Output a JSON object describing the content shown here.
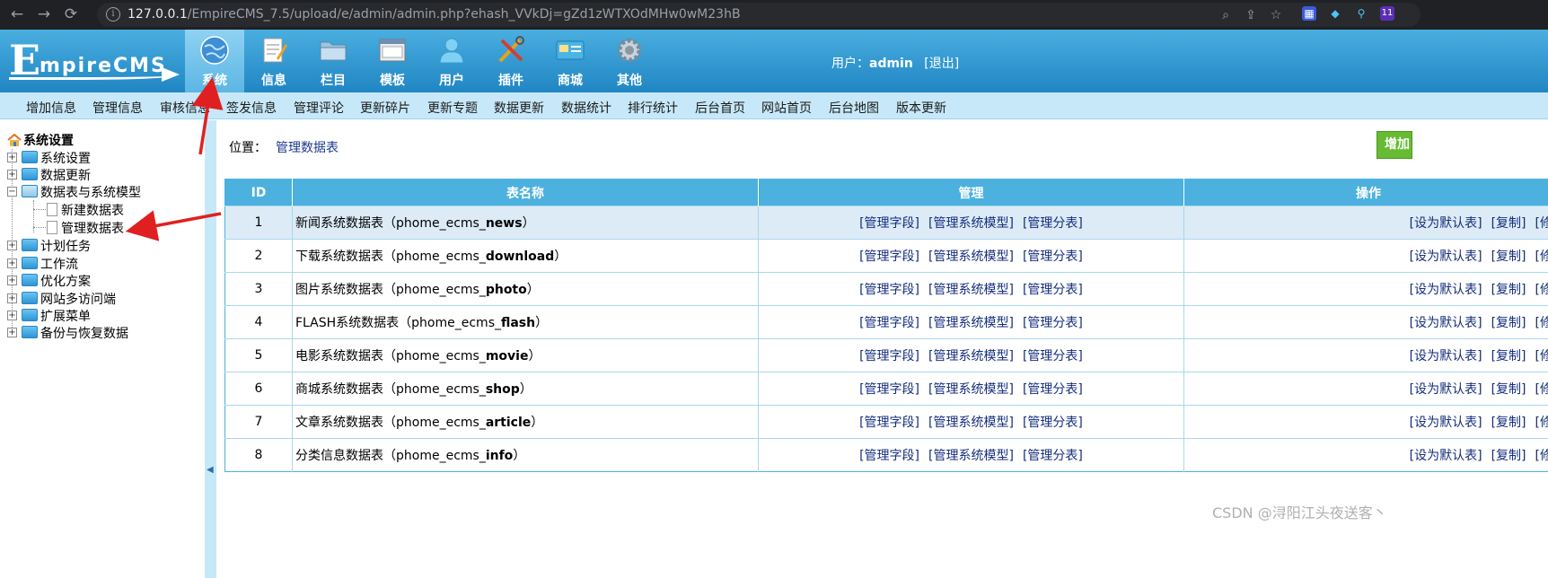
{
  "browser": {
    "url_host": "127.0.0.1",
    "url_path": "/EmpireCMS_7.5/upload/e/admin/admin.php?ehash_VVkDj=gZd1zWTXOdMHw0wM23hB",
    "ext_badge": "11"
  },
  "header": {
    "logo_e": "E",
    "logo_rest": "mpireCMS",
    "nav": [
      {
        "label": "系统",
        "icon": "globe-icon",
        "active": true
      },
      {
        "label": "信息",
        "icon": "notepad-icon"
      },
      {
        "label": "栏目",
        "icon": "folder-icon"
      },
      {
        "label": "模板",
        "icon": "window-icon"
      },
      {
        "label": "用户",
        "icon": "user-icon"
      },
      {
        "label": "插件",
        "icon": "tools-icon"
      },
      {
        "label": "商城",
        "icon": "shop-card-icon"
      },
      {
        "label": "其他",
        "icon": "gear-icon"
      }
    ],
    "user_prefix": "用户：",
    "user_name": "admin",
    "logout": "[退出]"
  },
  "submenu": [
    "增加信息",
    "管理信息",
    "审核信息",
    "签发信息",
    "管理评论",
    "更新碎片",
    "更新专题",
    "数据更新",
    "数据统计",
    "排行统计",
    "后台首页",
    "网站首页",
    "后台地图",
    "版本更新"
  ],
  "sidebar": {
    "root": "系统设置",
    "items": [
      "系统设置",
      "数据更新",
      "数据表与系统模型",
      "计划任务",
      "工作流",
      "优化方案",
      "网站多访问端",
      "扩展菜单",
      "备份与恢复数据"
    ],
    "children": [
      "新建数据表",
      "管理数据表"
    ]
  },
  "main": {
    "position_label": "位置：",
    "position_link": "管理数据表",
    "add_button": "增加"
  },
  "table": {
    "headers": [
      "ID",
      "表名称",
      "管理",
      "操作"
    ],
    "manage_links": [
      "[管理字段]",
      "[管理系统模型]",
      "[管理分表]"
    ],
    "op_links": [
      "[设为默认表]",
      "[复制]",
      "[修"
    ],
    "rows": [
      {
        "id": "1",
        "name": "新闻系统数据表（phome_ecms_",
        "table": "news",
        "end": "）"
      },
      {
        "id": "2",
        "name": "下载系统数据表（phome_ecms_",
        "table": "download",
        "end": "）"
      },
      {
        "id": "3",
        "name": "图片系统数据表（phome_ecms_",
        "table": "photo",
        "end": "）"
      },
      {
        "id": "4",
        "name": "FLASH系统数据表（phome_ecms_",
        "table": "flash",
        "end": "）"
      },
      {
        "id": "5",
        "name": "电影系统数据表（phome_ecms_",
        "table": "movie",
        "end": "）"
      },
      {
        "id": "6",
        "name": "商城系统数据表（phome_ecms_",
        "table": "shop",
        "end": "）"
      },
      {
        "id": "7",
        "name": "文章系统数据表（phome_ecms_",
        "table": "article",
        "end": "）"
      },
      {
        "id": "8",
        "name": "分类信息数据表（phome_ecms_",
        "table": "info",
        "end": "）"
      }
    ]
  },
  "watermark": "CSDN @浔阳江头夜送客丶",
  "colors": {
    "header": "#2b98d1",
    "submenu": "#c7e8f8",
    "table_header": "#4cb1de",
    "link": "#142d7c",
    "arrow": "#e02020"
  }
}
